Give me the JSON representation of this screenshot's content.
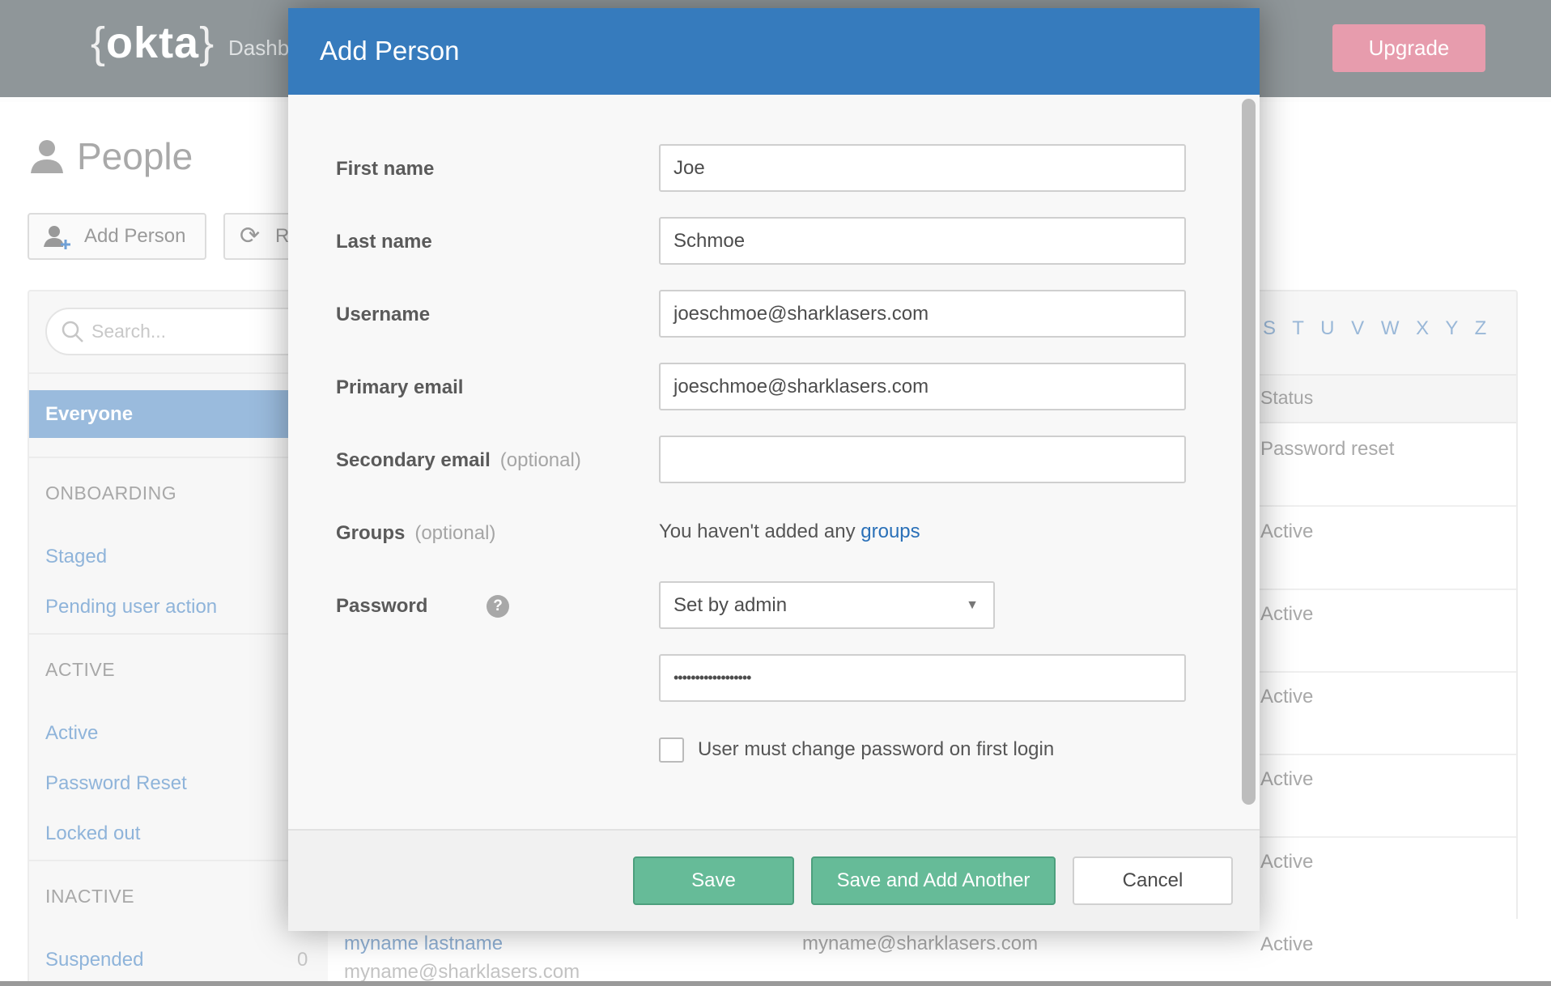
{
  "topbar": {
    "logo": "okta",
    "nav_partial": "Dashb",
    "upgrade": "Upgrade"
  },
  "page": {
    "title": "People",
    "add_person": "Add Person",
    "refresh_partial": "R",
    "search_placeholder": "Search...",
    "sidebar": {
      "everyone": "Everyone",
      "sections": [
        {
          "title": "ONBOARDING",
          "items": [
            "Staged",
            "Pending user action"
          ]
        },
        {
          "title": "ACTIVE",
          "items": [
            "Active",
            "Password Reset",
            "Locked out"
          ]
        },
        {
          "title": "INACTIVE",
          "items": [
            "Suspended"
          ]
        }
      ],
      "suspended_count": "0"
    },
    "letters": "S T U V W X Y Z",
    "table": {
      "status_header": "Status",
      "statuses": [
        "Password reset",
        "Active",
        "Active",
        "Active",
        "Active",
        "Active",
        "Active"
      ],
      "last_row": {
        "name": "myname lastname",
        "username": "myname@sharklasers.com",
        "email": "myname@sharklasers.com"
      }
    }
  },
  "modal": {
    "title": "Add Person",
    "fields": {
      "first_name": {
        "label": "First name",
        "value": "Joe"
      },
      "last_name": {
        "label": "Last name",
        "value": "Schmoe"
      },
      "username": {
        "label": "Username",
        "value": "joeschmoe@sharklasers.com"
      },
      "primary_email": {
        "label": "Primary email",
        "value": "joeschmoe@sharklasers.com"
      },
      "secondary_email": {
        "label": "Secondary email",
        "optional": "(optional)",
        "value": ""
      },
      "groups": {
        "label": "Groups",
        "optional": "(optional)",
        "text": "You haven't added any ",
        "link": "groups"
      },
      "password": {
        "label": "Password",
        "help": "?",
        "select": "Set by admin",
        "value": "••••••••••••••••••"
      },
      "must_change": {
        "label": "User must change password on first login",
        "checked": false
      }
    },
    "buttons": {
      "save": "Save",
      "save_add": "Save and Add Another",
      "cancel": "Cancel"
    }
  },
  "colors": {
    "header": "#367bbd",
    "save": "#66bb98",
    "upgrade": "#e79cad",
    "link": "#2a70b8"
  }
}
